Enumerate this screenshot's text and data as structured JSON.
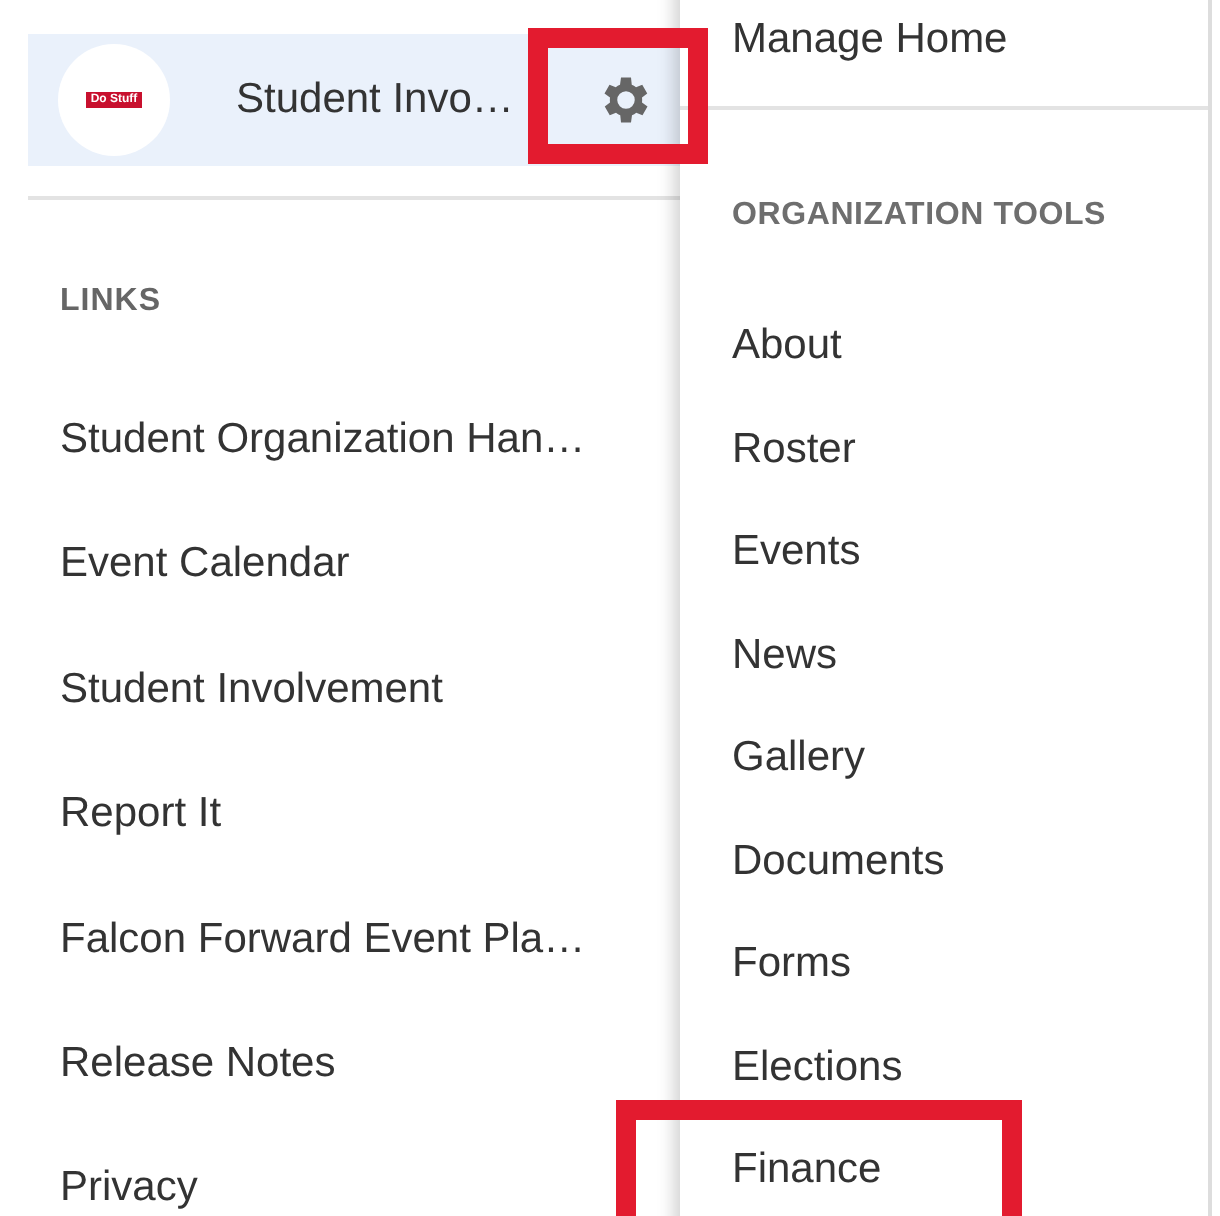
{
  "header": {
    "logo_text": "Do Stuff",
    "title": "Student Invo…"
  },
  "links": {
    "heading": "LINKS",
    "items": [
      "Student Organization Han…",
      "Event Calendar",
      "Student Involvement",
      "Report It",
      "Falcon Forward Event Pla…",
      "Release Notes",
      "Privacy"
    ]
  },
  "menu": {
    "top_item": "Manage Home",
    "heading": "ORGANIZATION TOOLS",
    "items": [
      {
        "label": "About",
        "highlighted": false
      },
      {
        "label": "Roster",
        "highlighted": false
      },
      {
        "label": "Events",
        "highlighted": false
      },
      {
        "label": "News",
        "highlighted": false
      },
      {
        "label": "Gallery",
        "highlighted": false
      },
      {
        "label": "Documents",
        "highlighted": false
      },
      {
        "label": "Forms",
        "highlighted": false
      },
      {
        "label": "Elections",
        "highlighted": false
      },
      {
        "label": "Finance",
        "highlighted": true
      }
    ]
  },
  "gear_highlighted": true
}
